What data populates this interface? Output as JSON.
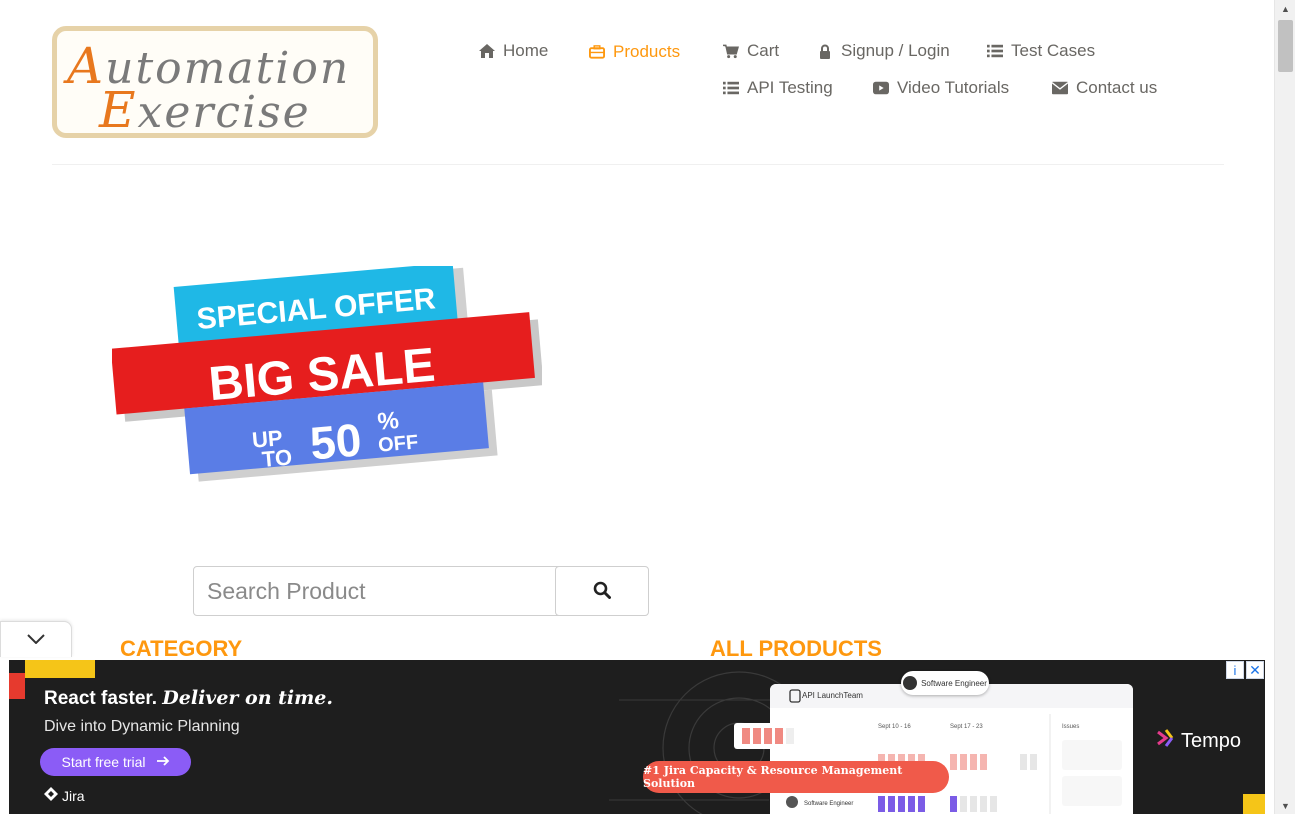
{
  "logo": {
    "line1_cap": "A",
    "line1_rest": "utomation",
    "line2_cap": "E",
    "line2_rest": "xercise"
  },
  "nav": [
    {
      "label": "Home",
      "icon": "home-icon"
    },
    {
      "label": "Products",
      "icon": "briefcase-icon",
      "active": true
    },
    {
      "label": "Cart",
      "icon": "cart-icon"
    },
    {
      "label": "Signup / Login",
      "icon": "lock-icon"
    },
    {
      "label": "Test Cases",
      "icon": "list-icon"
    },
    {
      "label": "API Testing",
      "icon": "list-icon"
    },
    {
      "label": "Video Tutorials",
      "icon": "youtube-play-icon"
    },
    {
      "label": "Contact us",
      "icon": "envelope-icon"
    }
  ],
  "banner": {
    "line1": "SPECIAL OFFER",
    "line2": "BIG SALE",
    "up": "UP",
    "to": "TO",
    "percent": "50",
    "pct_sign": "%",
    "off": "OFF"
  },
  "search": {
    "placeholder": "Search Product",
    "value": ""
  },
  "sections": {
    "category": "CATEGORY",
    "all_products": "ALL PRODUCTS"
  },
  "ad": {
    "headline": "React faster.",
    "headline_italic": "Deliver on time.",
    "subline": "Dive into Dynamic Planning",
    "cta": "Start free trial",
    "jira": "Jira",
    "screen_title": "API LaunchTeam",
    "col1": "Sept 10 - 16",
    "col2": "Sept 17 - 23",
    "col3": "Issues",
    "row_label": "Software Engineer",
    "pill": "Software Engineer",
    "badge": "#1 Jira Capacity & Resource Management Solution",
    "brand": "Tempo",
    "info": "i",
    "close": "✕"
  },
  "colors": {
    "accent": "#fe980f",
    "text": "#696763",
    "ad_bg": "#1e1e1e",
    "ad_cta": "#8b5cf6",
    "ad_badge": "#f05a4a"
  }
}
